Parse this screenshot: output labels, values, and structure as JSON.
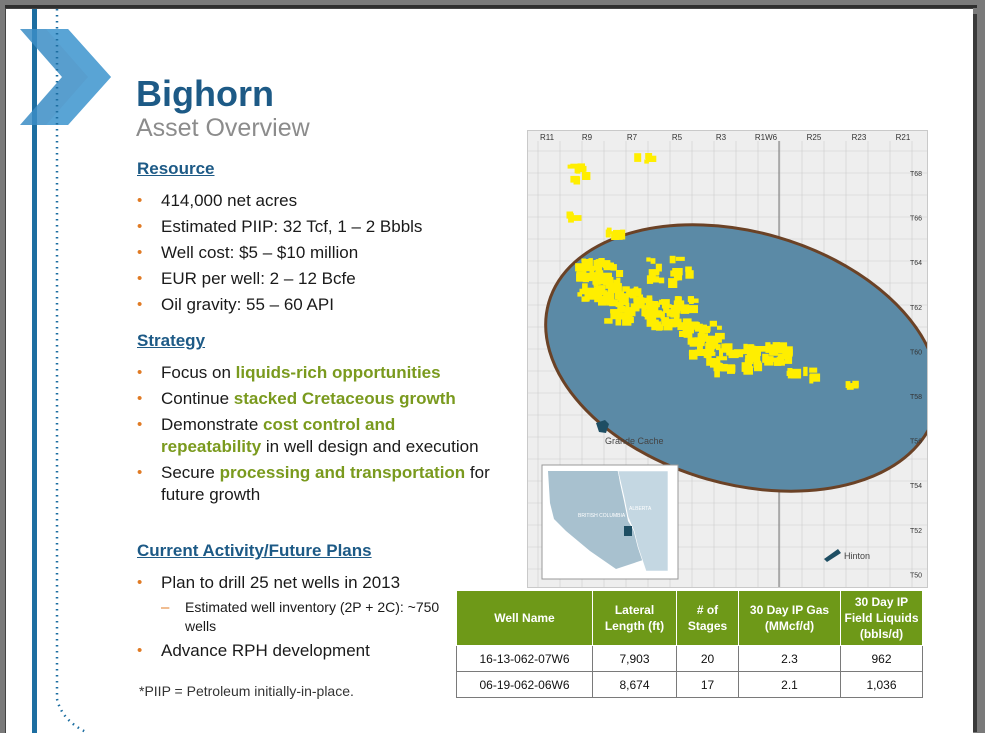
{
  "header": {
    "title": "Bighorn",
    "subtitle": "Asset Overview"
  },
  "resource": {
    "heading": "Resource",
    "items": [
      "414,000 net acres",
      "Estimated PIIP: 32 Tcf, 1 – 2 Bbbls",
      "Well cost: $5 – $10 million",
      "EUR per well: 2 – 12 Bcfe",
      "Oil gravity: 55 – 60 API"
    ]
  },
  "strategy": {
    "heading": "Strategy",
    "items": [
      {
        "pre": "Focus on ",
        "hl": "liquids-rich opportunities",
        "post": ""
      },
      {
        "pre": "Continue ",
        "hl": "stacked Cretaceous growth",
        "post": ""
      },
      {
        "pre": "Demonstrate ",
        "hl": "cost control and repeatability",
        "post": " in well design and execution"
      },
      {
        "pre": "Secure ",
        "hl": "processing and transportation",
        "post": " for future growth"
      }
    ]
  },
  "activity": {
    "heading": "Current Activity/Future Plans",
    "item1": "Plan to drill 25 net wells in 2013",
    "sub1": "Estimated well inventory (2P + 2C): ~750 wells",
    "item2": "Advance RPH development"
  },
  "footnote": "*PIIP = Petroleum initially-in-place.",
  "map": {
    "ranges": [
      "R11",
      "R9",
      "R7",
      "R5",
      "R3",
      "R1W6",
      "R25",
      "R23",
      "R21"
    ],
    "townships": [
      "T68",
      "T66",
      "T64",
      "T62",
      "T60",
      "T58",
      "T56",
      "T54",
      "T52",
      "T50"
    ],
    "town1": "Grande Cache",
    "town2": "Hinton",
    "inset_bc": "BRITISH COLUMBIA",
    "inset_ab": "ALBERTA",
    "colors": {
      "land": "#eeeeee",
      "play": "#5b8aa6",
      "outline": "#6b4226",
      "acreage": "#ffee00"
    }
  },
  "table": {
    "headers": [
      "Well Name",
      "Lateral Length (ft)",
      "# of Stages",
      "30 Day IP Gas (MMcf/d)",
      "30 Day IP Field Liquids (bbls/d)"
    ],
    "rows": [
      [
        "16-13-062-07W6",
        "7,903",
        "20",
        "2.3",
        "962"
      ],
      [
        "06-19-062-06W6",
        "8,674",
        "17",
        "2.1",
        "1,036"
      ]
    ]
  }
}
